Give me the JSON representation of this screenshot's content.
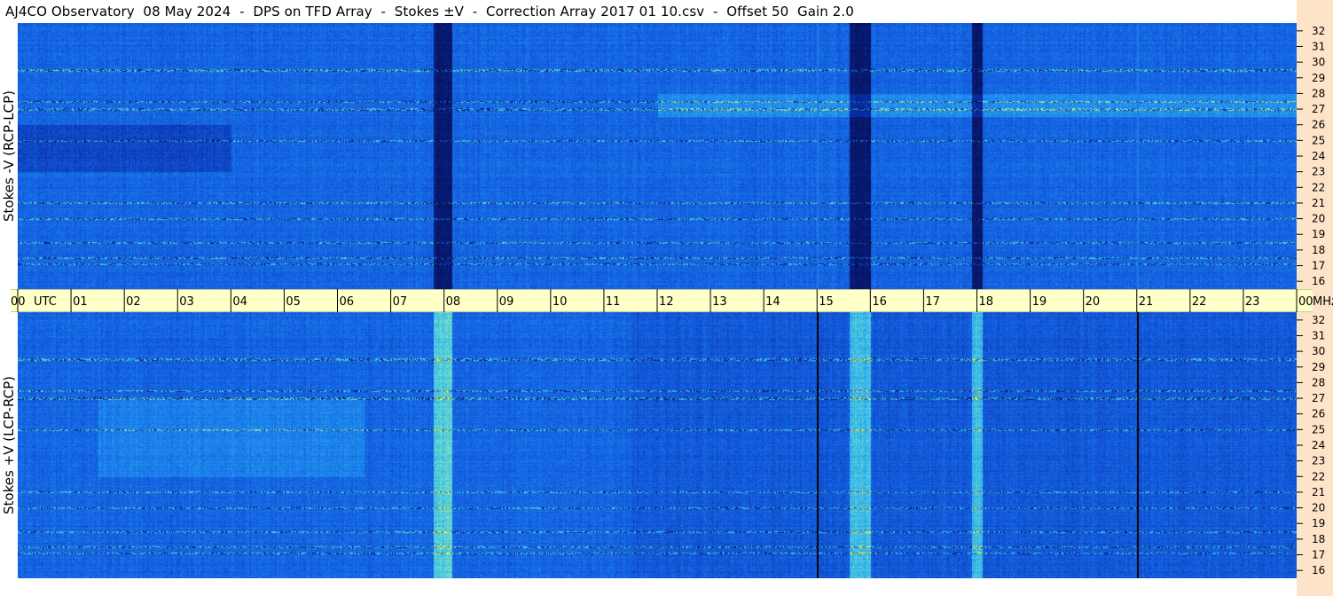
{
  "header": {
    "title": "AJ4CO Observatory  08 May 2024  -  DPS on TFD Array  -  Stokes ±V  -  Correction Array 2017 01 10.csv  -  Offset 50  Gain 2.0"
  },
  "colors": {
    "background_blue": "#1464e6",
    "dark_blue": "#0a1e78",
    "cyan": "#28b4f0",
    "green_yellow": "#b4f050",
    "time_axis_bg": "#ffffc8",
    "freq_axis_bg": "#fde3c8"
  },
  "chart_data": [
    {
      "type": "heatmap",
      "title": "Stokes -V (RCP-LCP)",
      "ylabel": "Stokes -V (RCP-LCP)",
      "x_label": "UTC",
      "y_unit": "MHz",
      "xlim": [
        0,
        24
      ],
      "ylim": [
        15.5,
        32.5
      ],
      "freq_ticks": [
        "16",
        "17",
        "18",
        "19",
        "20",
        "21",
        "22",
        "23",
        "24",
        "25",
        "26",
        "27",
        "28",
        "29",
        "30",
        "31",
        "32"
      ],
      "features": {
        "dark_bands_utc": [
          [
            7.8,
            8.15
          ],
          [
            15.6,
            16.0
          ],
          [
            17.9,
            18.1
          ]
        ],
        "interference_freqs_mhz": [
          17.1,
          17.5,
          18.5,
          20.0,
          21.0,
          25.0,
          27.0,
          27.5,
          29.5
        ]
      }
    },
    {
      "type": "heatmap",
      "title": "Stokes +V (LCP-RCP)",
      "ylabel": "Stokes +V (LCP-RCP)",
      "x_label": "UTC",
      "y_unit": "MHz",
      "xlim": [
        0,
        24
      ],
      "ylim": [
        15.5,
        32.5
      ],
      "freq_ticks": [
        "16",
        "17",
        "18",
        "19",
        "20",
        "21",
        "22",
        "23",
        "24",
        "25",
        "26",
        "27",
        "28",
        "29",
        "30",
        "31",
        "32"
      ],
      "features": {
        "bright_bands_utc": [
          [
            7.8,
            8.15
          ],
          [
            15.6,
            16.0
          ],
          [
            17.9,
            18.1
          ]
        ],
        "interference_freqs_mhz": [
          17.1,
          17.5,
          18.5,
          20.0,
          21.0,
          25.0,
          27.0,
          27.5,
          29.5
        ]
      }
    }
  ],
  "time_axis": {
    "labels": [
      "00",
      "01",
      "02",
      "03",
      "04",
      "05",
      "06",
      "07",
      "08",
      "09",
      "10",
      "11",
      "12",
      "13",
      "14",
      "15",
      "16",
      "17",
      "18",
      "19",
      "20",
      "21",
      "22",
      "23",
      "00"
    ],
    "utc_label": "UTC",
    "unit_label": "MHz"
  }
}
